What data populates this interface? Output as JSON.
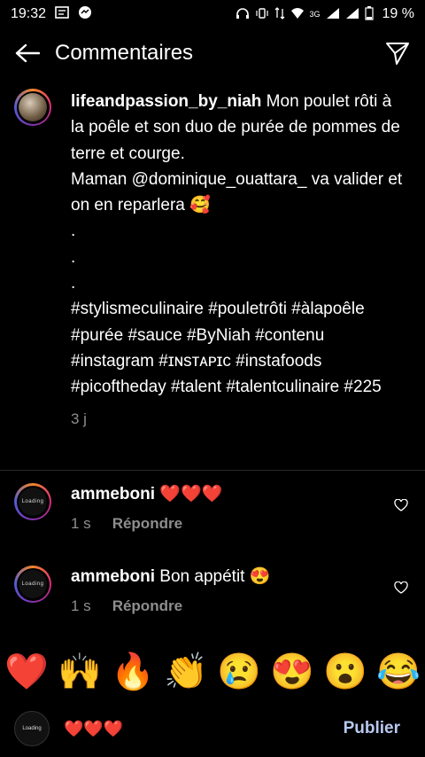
{
  "status": {
    "time": "19:32",
    "network": "3G",
    "battery": "19 %"
  },
  "header": {
    "title": "Commentaires"
  },
  "caption": {
    "username": "lifeandpassion_by_niah",
    "text": " Mon poulet rôti à la poêle et son duo de purée de pommes de terre et courge.\nMaman @dominique_ouattara_ va valider et on en reparlera 🥰\n.\n.\n.\n#stylismeculinaire #pouletrôti #àlapoêle #purée #sauce #ByNiah #contenu #instagram #ɪɴsᴛᴀᴘɪᴄ #instafoods #picoftheday #talent #talentculinaire #225",
    "time": "3 j"
  },
  "comments": [
    {
      "username": "ammeboni",
      "text": " ❤️❤️❤️",
      "time": "1 s",
      "reply": "Répondre",
      "avatar_text": "Loading"
    },
    {
      "username": "ammeboni",
      "text": " Bon appétit 😍",
      "time": "1 s",
      "reply": "Répondre",
      "avatar_text": "Loading"
    }
  ],
  "reactions": [
    "❤️",
    "🙌",
    "🔥",
    "👏",
    "😢",
    "😍",
    "😮",
    "😂"
  ],
  "composer": {
    "value": "❤️❤️❤️",
    "publish_label": "Publier",
    "avatar_text": "Loading"
  },
  "colors": {
    "background": "#000000",
    "publish": "#b8c8ef",
    "meta": "#8e8e8e"
  }
}
